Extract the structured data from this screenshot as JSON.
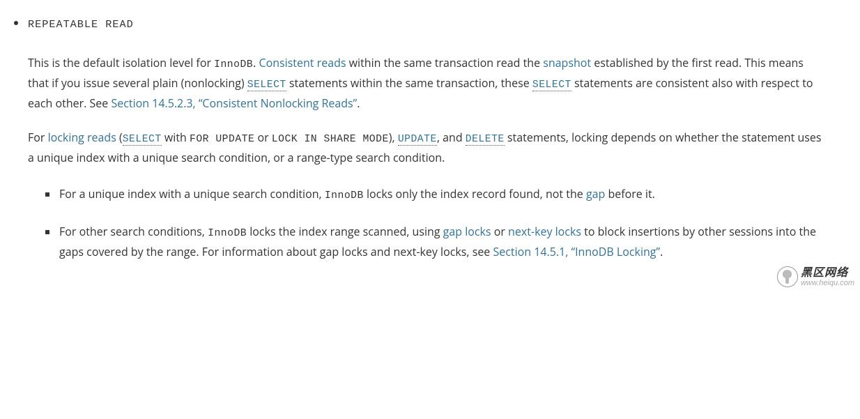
{
  "term": "REPEATABLE READ",
  "p1": {
    "t1": "This is the default isolation level for ",
    "innodb": "InnoDB",
    "t2": ". ",
    "link_consistent": "Consistent reads",
    "t3": " within the same transaction read the ",
    "link_snapshot": "snapshot",
    "t4": " established by the first read. This means that if you issue several plain (nonlocking) ",
    "select1": "SELECT",
    "t5": " statements within the same transaction, these ",
    "select2": "SELECT",
    "t6": " statements are consistent also with respect to each other. See ",
    "link_section": "Section 14.5.2.3, “Consistent Nonlocking Reads”",
    "t7": "."
  },
  "p2": {
    "t1": "For ",
    "link_locking": "locking reads",
    "t2": " (",
    "select": "SELECT",
    "t3": " with ",
    "for_update": "FOR UPDATE",
    "t4": " or ",
    "lock_share": "LOCK IN SHARE MODE",
    "t5": "), ",
    "update": "UPDATE",
    "t6": ", and ",
    "delete": "DELETE",
    "t7": " statements, locking depends on whether the statement uses a unique index with a unique search condition, or a range-type search condition."
  },
  "li1": {
    "t1": "For a unique index with a unique search condition, ",
    "innodb": "InnoDB",
    "t2": " locks only the index record found, not the ",
    "link_gap": "gap",
    "t3": " before it."
  },
  "li2": {
    "t1": "For other search conditions, ",
    "innodb": "InnoDB",
    "t2": " locks the index range scanned, using ",
    "link_gaplocks": "gap locks",
    "t3": " or ",
    "link_nextkey": "next-key locks",
    "t4": " to block insertions by other sessions into the gaps covered by the range. For information about gap locks and next-key locks, see ",
    "link_section": "Section 14.5.1, “InnoDB Locking”",
    "t5": "."
  },
  "watermark": {
    "title": "黑区网络",
    "url": "www.heiqu.com"
  }
}
